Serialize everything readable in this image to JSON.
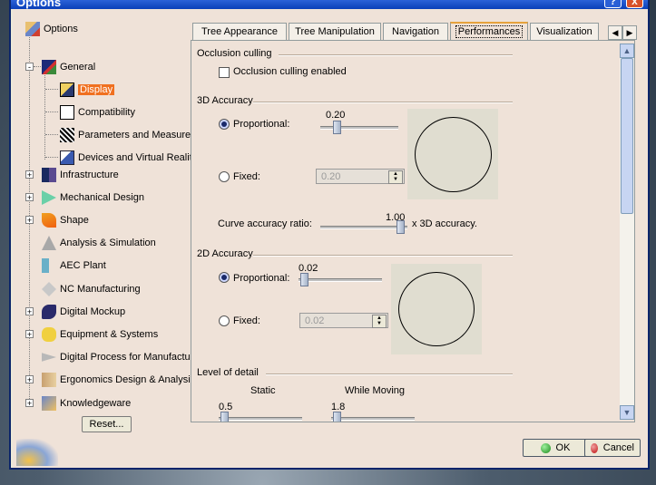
{
  "window": {
    "title": "Options",
    "help_label": "?",
    "close_label": "x"
  },
  "tree": {
    "root": "Options",
    "items": [
      {
        "label": "General",
        "icon": "general-icon"
      },
      {
        "label": "Display",
        "icon": "display-icon",
        "selected": true
      },
      {
        "label": "Compatibility",
        "icon": "compatibility-icon"
      },
      {
        "label": "Parameters and Measure",
        "icon": "parameters-icon"
      },
      {
        "label": "Devices and Virtual Reality",
        "icon": "devices-icon"
      },
      {
        "label": "Infrastructure",
        "icon": "infrastructure-icon"
      },
      {
        "label": "Mechanical Design",
        "icon": "mechanical-design-icon"
      },
      {
        "label": "Shape",
        "icon": "shape-icon"
      },
      {
        "label": "Analysis & Simulation",
        "icon": "analysis-icon"
      },
      {
        "label": "AEC Plant",
        "icon": "aec-plant-icon"
      },
      {
        "label": "NC Manufacturing",
        "icon": "nc-manufacturing-icon"
      },
      {
        "label": "Digital Mockup",
        "icon": "digital-mockup-icon"
      },
      {
        "label": "Equipment & Systems",
        "icon": "equipment-icon"
      },
      {
        "label": "Digital Process for Manufactur",
        "icon": "digital-process-icon"
      },
      {
        "label": "Ergonomics Design & Analysis",
        "icon": "ergonomics-icon"
      },
      {
        "label": "Knowledgeware",
        "icon": "knowledgeware-icon"
      }
    ],
    "expander_symbol": "-",
    "collapsed_symbol": "+"
  },
  "reset_label": "Reset...",
  "tabs": [
    "Tree Appearance",
    "Tree Manipulation",
    "Navigation",
    "Performances",
    "Visualization"
  ],
  "active_tab": "Performances",
  "tab_scroll": {
    "left": "◀",
    "right": "▶"
  },
  "occlusion": {
    "title": "Occlusion culling",
    "checkbox_label": "Occlusion culling enabled",
    "checked": false
  },
  "accuracy3d": {
    "title": "3D Accuracy",
    "proportional_label": "Proportional:",
    "proportional_value": "0.20",
    "fixed_label": "Fixed:",
    "fixed_value": "0.20",
    "curve_label": "Curve accuracy ratio:",
    "curve_value": "1.00",
    "curve_suffix": "x 3D accuracy."
  },
  "accuracy2d": {
    "title": "2D Accuracy",
    "proportional_label": "Proportional:",
    "proportional_value": "0.02",
    "fixed_label": "Fixed:",
    "fixed_value": "0.02"
  },
  "level_of_detail": {
    "title": "Level of detail",
    "static_label": "Static",
    "static_value": "0.5",
    "moving_label": "While Moving",
    "moving_value": "1.8"
  },
  "scrollbar": {
    "up": "▲",
    "down": "▼"
  },
  "buttons": {
    "ok": "OK",
    "cancel": "Cancel"
  },
  "colors": {
    "selection": "#f07020",
    "ok_dot": "#2aa52a",
    "cancel_dot": "#d02020",
    "panel_bg": "#efe2d8"
  }
}
